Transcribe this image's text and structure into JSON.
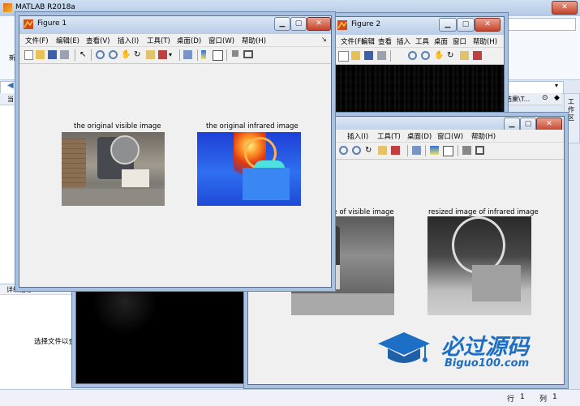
{
  "matlab": {
    "title": "MATLAB R2018a",
    "side_label": "工作区",
    "details_label": "详细信息",
    "select_hint": "选择文件以查看",
    "path_fragment": "会结果\\T...",
    "status_row_label": "行",
    "status_row_value": "1",
    "status_col_label": "列",
    "status_col_value": "1",
    "left_letters": [
      "新",
      "当"
    ]
  },
  "figure1": {
    "title": "Figure 1",
    "menu": [
      "文件(F)",
      "编辑(E)",
      "查看(V)",
      "插入(I)",
      "工具(T)",
      "桌面(D)",
      "窗口(W)",
      "帮助(H)"
    ],
    "caption_visible": "the original visible image",
    "caption_infrared": "the original infrared image"
  },
  "figure2": {
    "title": "Figure 2",
    "menu": [
      "文件(F)",
      "编辑",
      "查看",
      "插入",
      "工具",
      "桌面",
      "窗口",
      "帮助(H)"
    ]
  },
  "figure3": {
    "menu": [
      "插入(I)",
      "工具(T)",
      "桌面(D)",
      "窗口(W)",
      "帮助(H)"
    ],
    "caption_visible": "ge of visible image",
    "caption_infrared": "resized image of infrared image"
  },
  "watermark": {
    "text": "必过源码",
    "url": "Biguo100.com"
  },
  "colors": {
    "titlebar": "#c3d6ee",
    "close": "#c4432c",
    "watermark": "#1c6fc4"
  }
}
